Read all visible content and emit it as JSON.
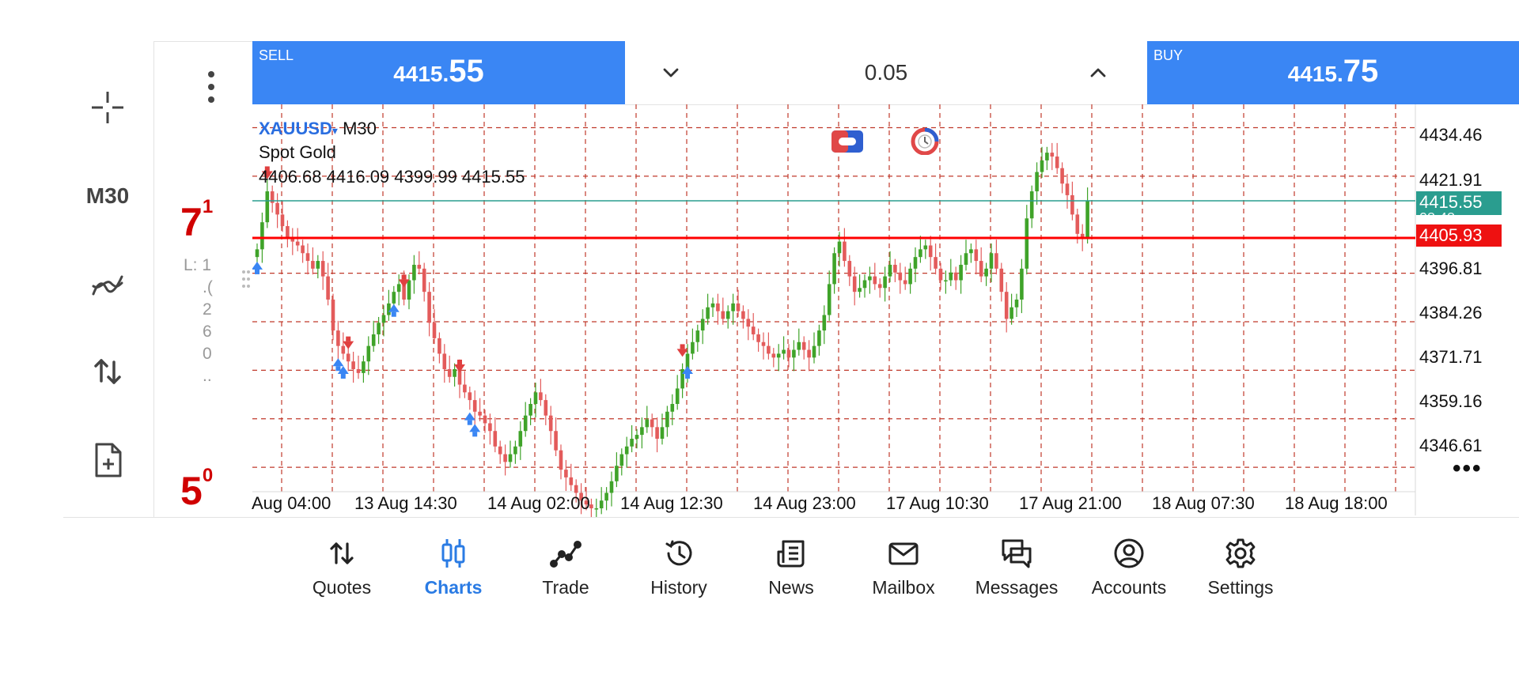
{
  "toolbar": {
    "timeframe": "M30",
    "big_digits": [
      {
        "main": "7",
        "sup": "1"
      },
      {
        "main": "5",
        "sup": "0"
      }
    ],
    "side_info": [
      "L: 1",
      ".(",
      "2",
      "6",
      "0",
      ".."
    ]
  },
  "trade": {
    "sell_label": "SELL",
    "sell_price_small": "4415.",
    "sell_price_big": "55",
    "buy_label": "BUY",
    "buy_price_small": "4415.",
    "buy_price_big": "75",
    "lot": "0.05"
  },
  "chart": {
    "symbol": "XAUUSD",
    "dropdown_glyph": "▾",
    "timeframe": "M30",
    "description": "Spot Gold",
    "ohlc": "4406.68 4416.09 4399.99 4415.55",
    "price_levels": [
      "4434.46",
      "4421.91",
      "4396.81",
      "4384.26",
      "4371.71",
      "4359.16",
      "4346.61"
    ],
    "bid_tag": "4415.55",
    "bid_tag_sub": "08:48",
    "line_tag": "4405.93",
    "time_labels": [
      "Aug 04:00",
      "13 Aug 14:30",
      "14 Aug 02:00",
      "14 Aug 12:30",
      "14 Aug 23:00",
      "17 Aug 10:30",
      "17 Aug 21:00",
      "18 Aug 07:30",
      "18 Aug 18:00"
    ],
    "more_glyph": "•••",
    "colors": {
      "up": "#3fa329",
      "down": "#e35b5b",
      "grid": "#c0392b",
      "bid_line": "#2a9d8f",
      "level_line": "#ff0000",
      "buy_arrow": "#3a86f4",
      "sell_arrow": "#e04040"
    }
  },
  "chart_data": {
    "type": "candlestick",
    "symbol": "XAUUSD",
    "timeframe": "M30",
    "ylim": [
      4340.3,
      4440.5
    ],
    "bid": 4415.55,
    "horizontal_line": 4405.93,
    "closes": [
      4403,
      4410,
      4418,
      4415,
      4412,
      4409,
      4406,
      4405,
      4404,
      4402,
      4400,
      4398,
      4400,
      4396,
      4390,
      4382,
      4378,
      4376,
      4374,
      4372,
      4371,
      4374,
      4378,
      4381,
      4384,
      4386,
      4389,
      4392,
      4394,
      4390,
      4395,
      4399,
      4398,
      4392,
      4384,
      4380,
      4376,
      4372,
      4370,
      4372,
      4368,
      4366,
      4364,
      4361,
      4360,
      4358,
      4356,
      4352,
      4350,
      4348,
      4350,
      4352,
      4356,
      4360,
      4363,
      4366,
      4364,
      4360,
      4356,
      4351,
      4346,
      4344,
      4342,
      4340,
      4338,
      4337,
      4336,
      4336,
      4338,
      4340,
      4343,
      4347,
      4350,
      4352,
      4354,
      4355,
      4357,
      4359,
      4357,
      4354,
      4357,
      4361,
      4363,
      4367,
      4372,
      4376,
      4379,
      4382,
      4385,
      4388,
      4389,
      4387,
      4385,
      4387,
      4389,
      4387,
      4385,
      4383,
      4381,
      4379,
      4378,
      4376,
      4375,
      4376,
      4377,
      4375,
      4377,
      4379,
      4377,
      4375,
      4378,
      4382,
      4386,
      4394,
      4402,
      4405,
      4400,
      4396,
      4392,
      4393,
      4395,
      4396,
      4394,
      4393,
      4396,
      4399,
      4397,
      4395,
      4394,
      4398,
      4401,
      4403,
      4404,
      4401,
      4398,
      4395,
      4395,
      4397,
      4395,
      4399,
      4402,
      4403,
      4400,
      4396,
      4398,
      4402,
      4398,
      4392,
      4385,
      4388,
      4390,
      4398,
      4411,
      4418,
      4423,
      4426,
      4428,
      4427,
      4424,
      4420,
      4417,
      4412,
      4407,
      4406,
      4415.5
    ]
  }
}
